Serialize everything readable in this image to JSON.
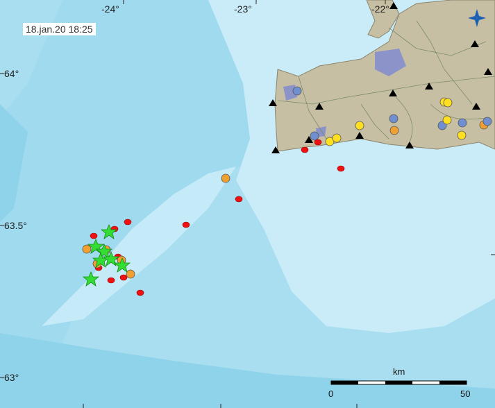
{
  "map": {
    "timestamp": "18.jan.20  18:25",
    "longitude_labels": [
      "-24°",
      "-23°",
      "-22°"
    ],
    "latitude_labels": [
      "64°",
      "63.5°",
      "63°"
    ],
    "scale": {
      "title": "km",
      "start": "0",
      "end": "50"
    },
    "colors": {
      "deep_sea": "#a9def0",
      "mid_sea": "#8fd3eb",
      "shallow_sea": "#c9ecf8",
      "land": "#c7bfa3",
      "lake": "#8c93c9",
      "earthquake_red": "#ee1111",
      "earthquake_orange": "#f0a030",
      "earthquake_yellow": "#ffe020",
      "earthquake_blue": "#6f8fd0",
      "major_quake_star": "#33dd33",
      "station": "#000000"
    },
    "icons": {
      "compass": "north-arrow-icon",
      "station": "seismic-station-triangle-icon",
      "major_quake": "green-star-icon"
    }
  }
}
